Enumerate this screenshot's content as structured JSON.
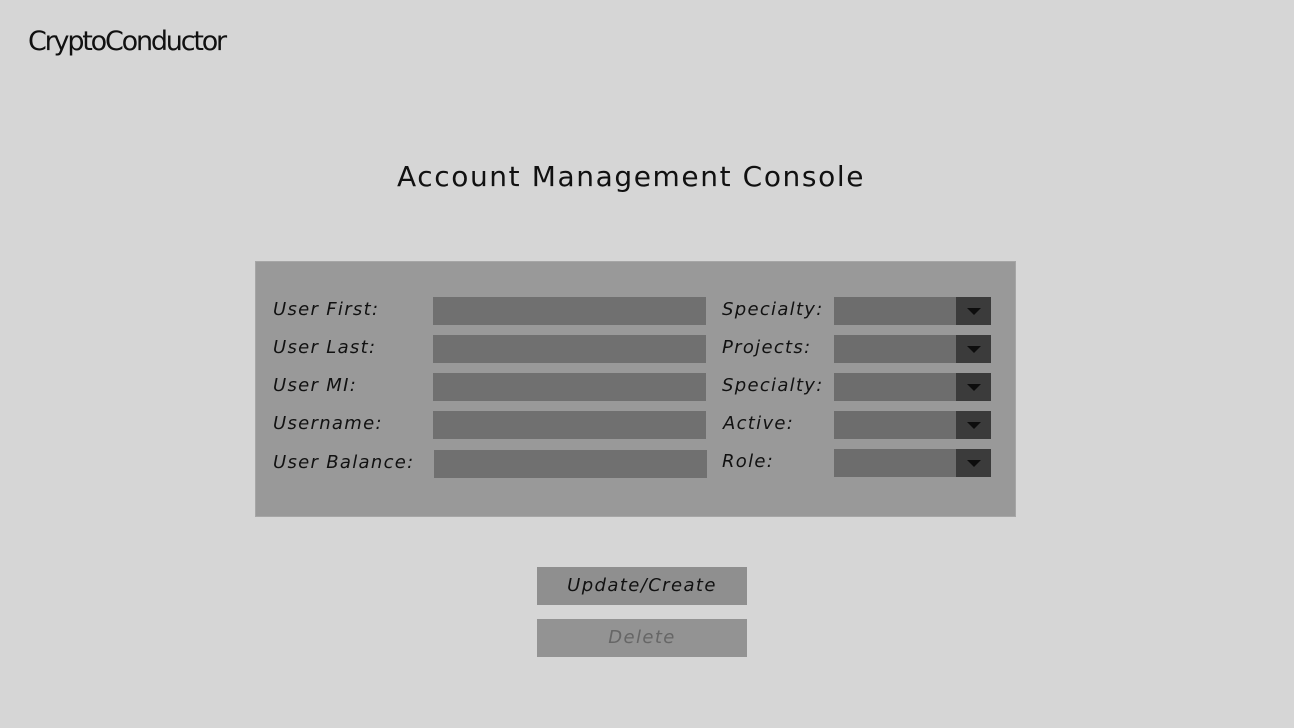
{
  "app": {
    "logo_text": "CryptoConductor"
  },
  "page": {
    "title": "Account Management Console"
  },
  "form": {
    "left_fields": [
      {
        "label": "User First:",
        "value": ""
      },
      {
        "label": "User Last:",
        "value": ""
      },
      {
        "label": "User MI:",
        "value": ""
      },
      {
        "label": "Username:",
        "value": ""
      },
      {
        "label": "User Balance:",
        "value": ""
      }
    ],
    "right_fields": [
      {
        "label": "Specialty:",
        "selected": ""
      },
      {
        "label": "Projects:",
        "selected": ""
      },
      {
        "label": "Specialty:",
        "selected": ""
      },
      {
        "label": "Active:",
        "selected": ""
      },
      {
        "label": "Role:",
        "selected": ""
      }
    ]
  },
  "actions": {
    "update_label": "Update/Create",
    "delete_label": "Delete"
  },
  "icons": {
    "dropdown": "chevron-down-icon"
  },
  "colors": {
    "background": "#d6d6d6",
    "panel": "#999999",
    "field": "#707070",
    "dropdown_button": "#3b3b3b",
    "button": "#8f8f8f",
    "disabled_text": "#666666"
  }
}
